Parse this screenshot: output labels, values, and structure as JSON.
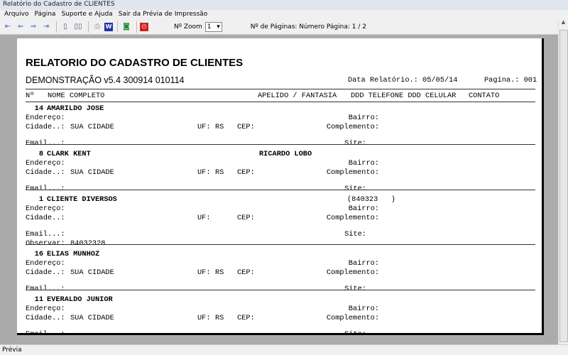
{
  "window": {
    "title": "Relatório do Cadastro de CLIENTES"
  },
  "menu": [
    "Arquivo",
    "Página",
    "Suporte e Ajuda",
    "Sair da Prévia de Impressão"
  ],
  "toolbar": {
    "zoom_label": "Nº Zoom",
    "zoom_value": "1",
    "pages_label": "Nº de Páginas: Número Página: 1 / 2"
  },
  "status": "Prévia",
  "report": {
    "title": "RELATORIO DO CADASTRO DE CLIENTES",
    "subtitle": "DEMONSTRAÇÃO v5.4 300914 010114",
    "date": "Data Relatório.: 05/05/14",
    "page": "Pagina.: 001",
    "headers": {
      "num": "Nº",
      "name": "NOME COMPLETO",
      "apelido": "APELIDO / FANTASIA",
      "phones": "DDD TELEFONE DDD CELULAR",
      "contato": "CONTATO"
    },
    "labels": {
      "endereco": "Endereço:",
      "cidade": "Cidade..:",
      "uf": "UF:",
      "cep": "CEP:",
      "bairro": "Bairro:",
      "complemento": "Complemento:",
      "email": "Email...:",
      "site": "Site:",
      "observar": "Observar:"
    },
    "records": [
      {
        "num": "14",
        "name": "AMARILDO JOSE",
        "apelido": "",
        "phone": "",
        "cidade": "SUA CIDADE",
        "uf": "RS",
        "obs": ""
      },
      {
        "num": "8",
        "name": "CLARK KENT",
        "apelido": "RICARDO LOBO",
        "phone": "",
        "cidade": "SUA CIDADE",
        "uf": "RS",
        "obs": ""
      },
      {
        "num": "1",
        "name": "CLIENTE DIVERSOS",
        "apelido": "",
        "phone": "(840323   )",
        "cidade": "",
        "uf": "",
        "obs": "84032328"
      },
      {
        "num": "16",
        "name": "ELIAS MUNHOZ",
        "apelido": "",
        "phone": "",
        "cidade": "SUA CIDADE",
        "uf": "RS",
        "obs": ""
      },
      {
        "num": "11",
        "name": "EVERALDO JUNIOR",
        "apelido": "",
        "phone": "",
        "cidade": "SUA CIDADE",
        "uf": "RS",
        "obs": ""
      }
    ]
  }
}
